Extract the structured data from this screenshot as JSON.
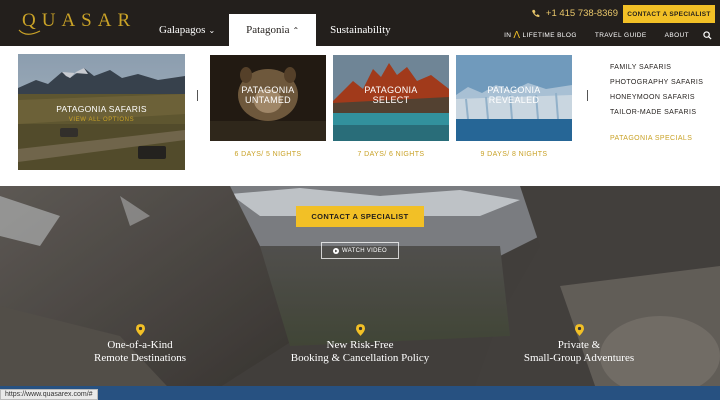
{
  "header": {
    "logo": "QUASAR",
    "nav": [
      {
        "label": "Galapagos",
        "chevron": "chevron-down-icon"
      },
      {
        "label": "Patagonia",
        "chevron": "chevron-up-icon"
      },
      {
        "label": "Sustainability"
      }
    ],
    "phone": "+1 415 738-8369",
    "cta": "CONTACT A SPECIALIST",
    "subnav": {
      "blog_prefix": "IN",
      "blog_suffix": "LIFETIME BLOG",
      "travel_guide": "TRAVEL GUIDE",
      "about": "ABOUT"
    }
  },
  "mega_menu": {
    "hero": {
      "title": "PATAGONIA SAFARIS",
      "link": "VIEW ALL OPTIONS"
    },
    "tiles": [
      {
        "line1": "PATAGONIA",
        "line2": "UNTAMED",
        "caption": "6 DAYS/ 5 NIGHTS"
      },
      {
        "line1": "PATAGONIA",
        "line2": "SELECT",
        "caption": "7 DAYS/ 6 NIGHTS"
      },
      {
        "line1": "PATAGONIA",
        "line2": "REVEALED",
        "caption": "9 DAYS/ 8 NIGHTS"
      }
    ],
    "side_links": [
      "FAMILY SAFARIS",
      "PHOTOGRAPHY SAFARIS",
      "HONEYMOON SAFARIS",
      "TAILOR-MADE SAFARIS"
    ],
    "special": "PATAGONIA SPECIALS"
  },
  "hero": {
    "cta": "CONTACT A SPECIALIST",
    "watch": "WATCH VIDEO",
    "features": [
      {
        "line1": "One-of-a-Kind",
        "line2": "Remote Destinations"
      },
      {
        "line1": "New Risk-Free",
        "line2": "Booking & Cancellation Policy"
      },
      {
        "line1": "Private &",
        "line2": "Small-Group Adventures"
      }
    ]
  },
  "status_url": "https://www.quasarex.com/#",
  "colors": {
    "gold": "#c9a227",
    "yellow": "#f2c026",
    "dark": "#231f1c"
  }
}
